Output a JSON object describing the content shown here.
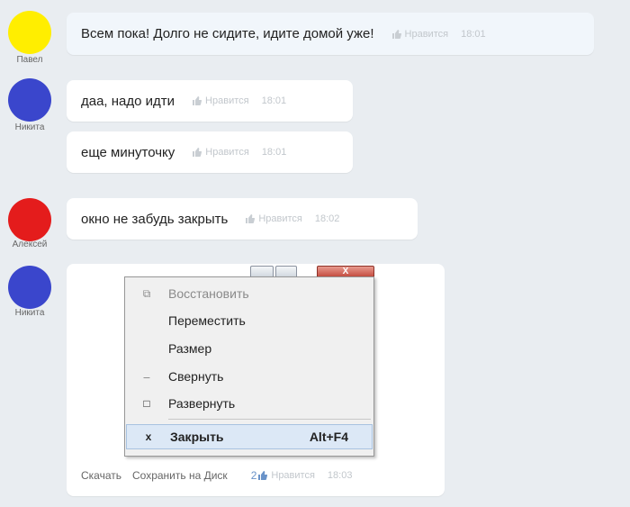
{
  "messages": [
    {
      "user": "Павел",
      "avatar_color": "#ffee00",
      "text": "Всем пока! Долго не сидите, идите домой уже!",
      "like": "Нравится",
      "time": "18:01"
    },
    {
      "user": "Никита",
      "avatar_color": "#3a46cc",
      "text": "даа, надо идти",
      "like": "Нравится",
      "time": "18:01"
    },
    {
      "user": "",
      "text": "еще минуточку",
      "like": "Нравится",
      "time": "18:01"
    },
    {
      "user": "Алексей",
      "avatar_color": "#e41c1c",
      "text": "окно не забудь закрыть",
      "like": "Нравится",
      "time": "18:02"
    },
    {
      "user": "Никита",
      "avatar_color": "#3a46cc"
    }
  ],
  "window_menu": {
    "items": [
      {
        "icon": "⧉",
        "label": "Восстановить",
        "disabled": true
      },
      {
        "icon": "",
        "label": "Переместить"
      },
      {
        "icon": "",
        "label": "Размер"
      },
      {
        "icon": "_",
        "label": "Свернуть"
      },
      {
        "icon": "□",
        "label": "Развернуть"
      }
    ],
    "close_item": {
      "icon": "x",
      "label": "Закрыть",
      "shortcut": "Alt+F4"
    },
    "close_button": "X"
  },
  "image_footer": {
    "download": "Скачать",
    "save": "Сохранить на Диск",
    "like_count": "2",
    "like": "Нравится",
    "time": "18:03"
  }
}
